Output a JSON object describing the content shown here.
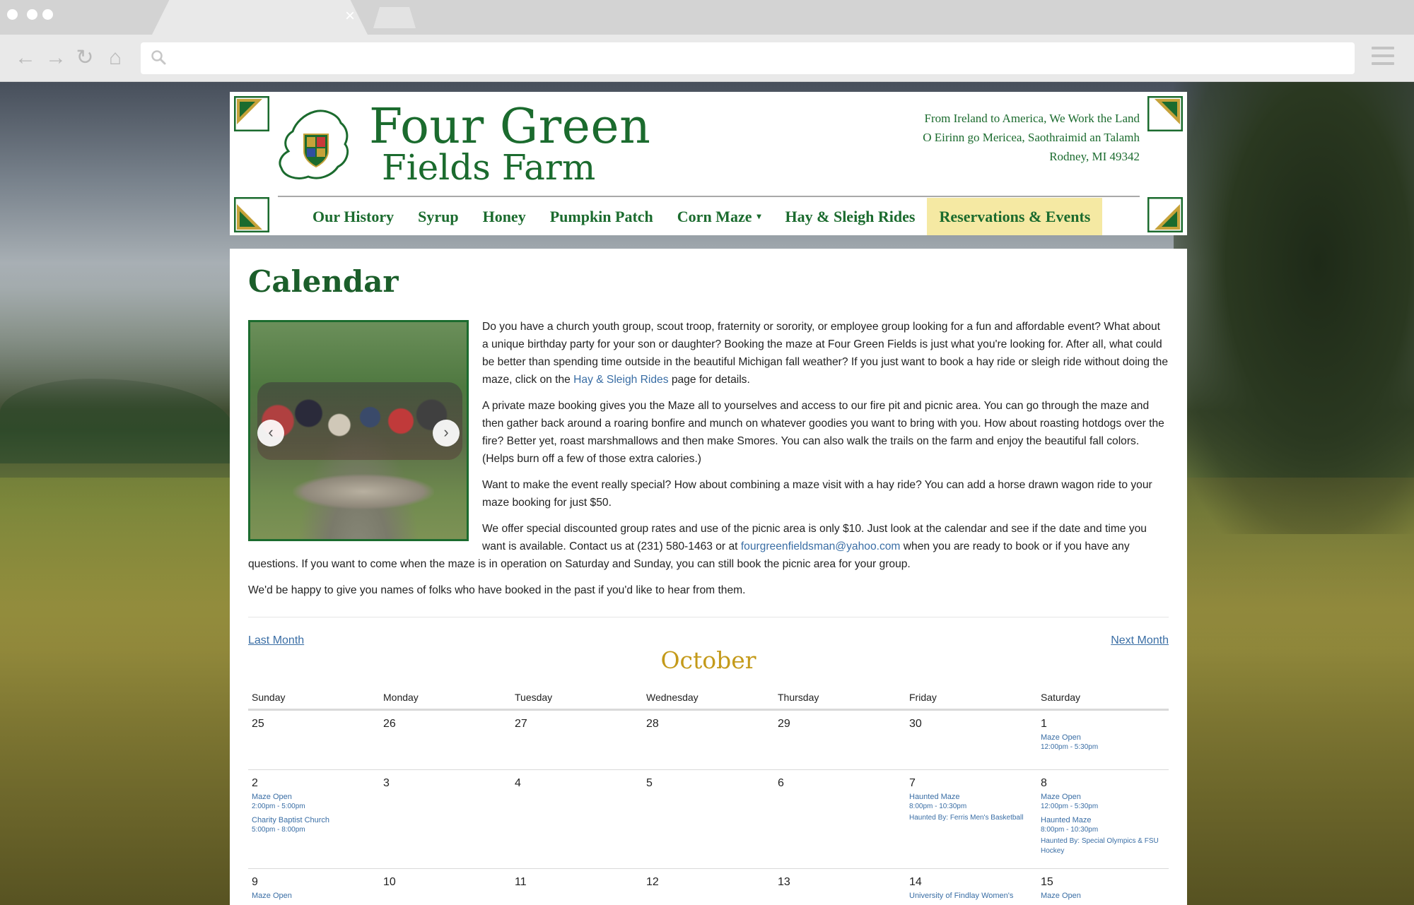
{
  "browser": {
    "tab_close": "×",
    "url": "",
    "icons": [
      "back-icon",
      "forward-icon",
      "reload-icon",
      "home-icon",
      "search-icon",
      "menu-icon"
    ]
  },
  "site": {
    "brand_line1": "Four Green",
    "brand_line2": "Fields Farm",
    "tagline": [
      "From Ireland to America, We Work the Land",
      "O Eirinn go Mericea, Saothraimid an Talamh",
      "Rodney, MI 49342"
    ],
    "nav": [
      {
        "label": "Our History",
        "caret": ""
      },
      {
        "label": "Syrup",
        "caret": ""
      },
      {
        "label": "Honey",
        "caret": ""
      },
      {
        "label": "Pumpkin Patch",
        "caret": ""
      },
      {
        "label": "Corn Maze",
        "caret": "▾"
      },
      {
        "label": "Hay & Sleigh Rides",
        "caret": ""
      },
      {
        "label": "Reservations & Events",
        "caret": ""
      }
    ],
    "colors": {
      "green": "#1b6b2e",
      "gold": "#c49a1a",
      "active_nav": "#f5e9a3",
      "link": "#3a6ea5"
    }
  },
  "page": {
    "title": "Calendar",
    "carousel": {
      "prev": "‹",
      "next": "›"
    },
    "p1_before": "Do you have a church youth group, scout troop, fraternity or sorority, or employee group looking for a fun and affordable event? What about a unique birthday party for your son or daughter? Booking the maze at Four Green Fields is just what you're looking for. After all, what could be better than spending time outside in the beautiful Michigan fall weather? If you just want to book a hay ride or sleigh ride without doing the maze, click on the ",
    "p1_link": "Hay & Sleigh Rides",
    "p1_after": " page for details.",
    "p2": "A private maze booking gives you the Maze all to yourselves and access to our fire pit and picnic area. You can go through the maze and then gather back around a roaring bonfire and munch on whatever goodies you want to bring with you. How about roasting hotdogs over the fire? Better yet, roast marshmallows and then make Smores. You can also walk the trails on the farm and enjoy the beautiful fall colors. (Helps burn off a few of those extra calories.)",
    "p3": "Want to make the event really special? How about combining a maze visit with a hay ride? You can add a horse drawn wagon ride to your maze booking for just $50.",
    "p4_before": "We offer special discounted group rates and use of the picnic area is only $10. Just look at the calendar and see if the date and time you want is available. Contact us at (231) 580-1463 or at ",
    "p4_link": "fourgreenfieldsman@yahoo.com",
    "p4_after": " when you are ready to book or if you have any questions. If you want to come when the maze is in operation on Saturday and Sunday, you can still book the picnic area for your group.",
    "p5": "We'd be happy to give you names of folks who have booked in the past if you'd like to hear from them."
  },
  "calendar": {
    "prev_label": "Last Month",
    "next_label": "Next Month",
    "month": "October",
    "weekdays": [
      "Sunday",
      "Monday",
      "Tuesday",
      "Wednesday",
      "Thursday",
      "Friday",
      "Saturday"
    ],
    "weeks": [
      [
        {
          "day": "25",
          "events": []
        },
        {
          "day": "26",
          "events": []
        },
        {
          "day": "27",
          "events": []
        },
        {
          "day": "28",
          "events": []
        },
        {
          "day": "29",
          "events": []
        },
        {
          "day": "30",
          "events": []
        },
        {
          "day": "1",
          "events": [
            {
              "name": "Maze Open",
              "time": "12:00pm - 5:30pm",
              "note": ""
            }
          ]
        }
      ],
      [
        {
          "day": "2",
          "events": [
            {
              "name": "Maze Open",
              "time": "2:00pm - 5:00pm",
              "note": ""
            },
            {
              "name": "Charity Baptist Church",
              "time": "5:00pm - 8:00pm",
              "note": ""
            }
          ]
        },
        {
          "day": "3",
          "events": []
        },
        {
          "day": "4",
          "events": []
        },
        {
          "day": "5",
          "events": []
        },
        {
          "day": "6",
          "events": []
        },
        {
          "day": "7",
          "events": [
            {
              "name": "Haunted Maze",
              "time": "8:00pm - 10:30pm",
              "note": "Haunted By: Ferris Men's Basketball"
            }
          ]
        },
        {
          "day": "8",
          "events": [
            {
              "name": "Maze Open",
              "time": "12:00pm - 5:30pm",
              "note": ""
            },
            {
              "name": "Haunted Maze",
              "time": "8:00pm - 10:30pm",
              "note": "Haunted By: Special Olympics & FSU Hockey"
            }
          ]
        }
      ],
      [
        {
          "day": "9",
          "events": [
            {
              "name": "Maze Open",
              "time": "",
              "note": ""
            }
          ]
        },
        {
          "day": "10",
          "events": []
        },
        {
          "day": "11",
          "events": []
        },
        {
          "day": "12",
          "events": []
        },
        {
          "day": "13",
          "events": []
        },
        {
          "day": "14",
          "events": [
            {
              "name": "University of Findlay Women's",
              "time": "",
              "note": ""
            }
          ]
        },
        {
          "day": "15",
          "events": [
            {
              "name": "Maze Open",
              "time": "",
              "note": ""
            }
          ]
        }
      ]
    ]
  }
}
